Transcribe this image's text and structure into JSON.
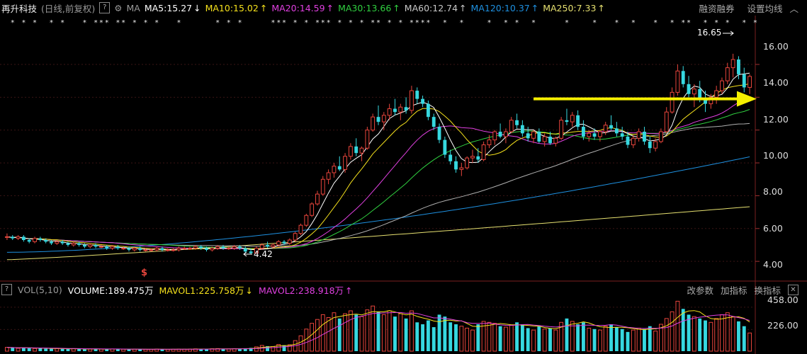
{
  "header": {
    "stock_name": "再升科技",
    "period": "(日线,前复权)",
    "help_label": "?",
    "ma_label": "MA",
    "ma5": "MA5:15.27",
    "ma10": "MA10:15.02",
    "ma20": "MA20:14.59",
    "ma30": "MA30:13.66",
    "ma60": "MA60:12.74",
    "ma120": "MA120:10.37",
    "ma250": "MA250:7.33",
    "arrow_down": "↓",
    "arrow_up": "↑",
    "margin_trading": "融资融券",
    "set_ma": "设置均线"
  },
  "volume_header": {
    "indicator": "VOL(5,10)",
    "volume": "VOLUME:189.475万",
    "mavol1": "MAVOL1:225.758万",
    "mavol2": "MAVOL2:238.918万",
    "change_params": "改参数",
    "add_indicator": "加指标",
    "switch_indicator": "换指标",
    "close_label": "✕"
  },
  "annotations": {
    "high_label": "16.65",
    "low_label": "4.42",
    "dollar_mark": "$"
  },
  "colors": {
    "up": "#e8453c",
    "down": "#36d8e0",
    "ma5": "#ffffff",
    "ma10": "#f5e11c",
    "ma20": "#e040e0",
    "ma30": "#30d040",
    "ma60": "#b0b0b0",
    "ma120": "#1e90e0",
    "ma250": "#e6e070",
    "trend_arrow": "#f5f000"
  },
  "chart_data": [
    {
      "type": "candlestick",
      "title": "再升科技 (日线,前复权)",
      "y_ticks": [
        "16.00",
        "14.00",
        "12.00",
        "10.00",
        "8.00",
        "6.00",
        "4.00"
      ],
      "ylim": [
        3.1,
        18.2
      ],
      "high": 16.65,
      "low": 4.42,
      "grid": true,
      "trend_arrow_level": 13.9,
      "candles": [
        [
          5.5,
          5.7,
          5.3,
          5.5
        ],
        [
          5.5,
          5.6,
          5.3,
          5.4
        ],
        [
          5.4,
          5.6,
          5.3,
          5.5
        ],
        [
          5.5,
          5.6,
          5.2,
          5.3
        ],
        [
          5.3,
          5.4,
          5.1,
          5.2
        ],
        [
          5.2,
          5.5,
          5.1,
          5.4
        ],
        [
          5.4,
          5.5,
          5.2,
          5.3
        ],
        [
          5.3,
          5.4,
          5.1,
          5.2
        ],
        [
          5.2,
          5.3,
          5.0,
          5.1
        ],
        [
          5.1,
          5.3,
          5.0,
          5.2
        ],
        [
          5.2,
          5.3,
          5.0,
          5.1
        ],
        [
          5.1,
          5.2,
          4.9,
          5.0
        ],
        [
          5.0,
          5.2,
          4.9,
          5.1
        ],
        [
          5.1,
          5.2,
          4.9,
          5.0
        ],
        [
          5.0,
          5.1,
          4.8,
          4.9
        ],
        [
          4.9,
          5.1,
          4.8,
          5.0
        ],
        [
          5.0,
          5.1,
          4.8,
          4.9
        ],
        [
          4.9,
          5.0,
          4.8,
          4.9
        ],
        [
          4.9,
          5.0,
          4.7,
          4.8
        ],
        [
          4.8,
          5.0,
          4.7,
          4.9
        ],
        [
          4.9,
          5.0,
          4.7,
          4.8
        ],
        [
          4.8,
          4.9,
          4.7,
          4.8
        ],
        [
          4.8,
          4.9,
          4.6,
          4.7
        ],
        [
          4.7,
          4.9,
          4.6,
          4.8
        ],
        [
          4.8,
          4.9,
          4.6,
          4.7
        ],
        [
          4.7,
          4.8,
          4.6,
          4.7
        ],
        [
          4.7,
          4.8,
          4.6,
          4.7
        ],
        [
          4.7,
          4.9,
          4.6,
          4.8
        ],
        [
          4.8,
          4.9,
          4.6,
          4.7
        ],
        [
          4.7,
          4.8,
          4.6,
          4.7
        ],
        [
          4.7,
          4.8,
          4.6,
          4.7
        ],
        [
          4.7,
          4.9,
          4.6,
          4.8
        ],
        [
          4.8,
          4.9,
          4.7,
          4.8
        ],
        [
          4.8,
          4.9,
          4.7,
          4.8
        ],
        [
          4.8,
          5.0,
          4.7,
          4.9
        ],
        [
          4.9,
          5.0,
          4.7,
          4.8
        ],
        [
          4.8,
          4.9,
          4.6,
          4.7
        ],
        [
          4.7,
          4.9,
          4.6,
          4.8
        ],
        [
          4.8,
          5.0,
          4.7,
          4.9
        ],
        [
          4.9,
          5.0,
          4.7,
          4.8
        ],
        [
          4.8,
          4.9,
          4.7,
          4.8
        ],
        [
          4.8,
          5.0,
          4.7,
          4.9
        ],
        [
          4.9,
          5.0,
          4.7,
          4.8
        ],
        [
          4.8,
          4.9,
          4.5,
          4.6
        ],
        [
          4.6,
          4.8,
          4.42,
          4.5
        ],
        [
          4.5,
          4.9,
          4.5,
          4.8
        ],
        [
          4.8,
          5.1,
          4.7,
          5.0
        ],
        [
          5.0,
          5.2,
          4.8,
          4.9
        ],
        [
          4.9,
          5.1,
          4.8,
          5.0
        ],
        [
          5.0,
          5.3,
          4.9,
          5.2
        ],
        [
          5.2,
          5.3,
          5.0,
          5.1
        ],
        [
          5.1,
          5.4,
          5.0,
          5.3
        ],
        [
          5.3,
          5.8,
          5.2,
          5.7
        ],
        [
          5.7,
          6.3,
          5.6,
          6.2
        ],
        [
          6.2,
          6.9,
          6.1,
          6.8
        ],
        [
          6.8,
          7.6,
          6.7,
          7.5
        ],
        [
          7.5,
          8.3,
          7.4,
          8.1
        ],
        [
          8.1,
          9.2,
          8.0,
          9.0
        ],
        [
          9.0,
          9.6,
          8.7,
          9.4
        ],
        [
          9.4,
          10.0,
          9.1,
          9.8
        ],
        [
          9.8,
          10.4,
          9.5,
          9.6
        ],
        [
          9.6,
          10.6,
          9.4,
          10.4
        ],
        [
          10.4,
          11.2,
          10.2,
          11.0
        ],
        [
          11.0,
          11.5,
          10.4,
          10.6
        ],
        [
          10.6,
          11.0,
          10.1,
          10.9
        ],
        [
          10.9,
          12.2,
          10.8,
          12.0
        ],
        [
          12.0,
          13.0,
          11.9,
          12.8
        ],
        [
          12.8,
          13.5,
          12.3,
          12.5
        ],
        [
          12.5,
          13.1,
          12.0,
          12.9
        ],
        [
          12.9,
          13.6,
          12.6,
          13.3
        ],
        [
          13.3,
          13.9,
          12.9,
          13.1
        ],
        [
          13.1,
          13.6,
          12.6,
          13.4
        ],
        [
          13.4,
          14.0,
          13.0,
          13.2
        ],
        [
          13.2,
          14.7,
          13.0,
          14.4
        ],
        [
          14.4,
          14.6,
          13.6,
          13.9
        ],
        [
          13.9,
          14.1,
          13.4,
          13.6
        ],
        [
          13.6,
          13.8,
          12.6,
          12.8
        ],
        [
          12.8,
          13.0,
          12.0,
          12.2
        ],
        [
          12.2,
          12.4,
          11.2,
          11.4
        ],
        [
          11.4,
          11.6,
          10.3,
          10.5
        ],
        [
          10.5,
          10.8,
          9.9,
          10.1
        ],
        [
          10.1,
          10.4,
          9.4,
          9.6
        ],
        [
          9.6,
          10.0,
          9.2,
          9.7
        ],
        [
          9.7,
          10.4,
          9.6,
          10.3
        ],
        [
          10.3,
          10.8,
          10.0,
          10.4
        ],
        [
          10.4,
          10.9,
          10.0,
          10.2
        ],
        [
          10.2,
          11.3,
          10.1,
          11.1
        ],
        [
          11.1,
          11.7,
          10.9,
          11.4
        ],
        [
          11.4,
          12.0,
          11.1,
          11.9
        ],
        [
          11.9,
          12.4,
          11.5,
          11.6
        ],
        [
          11.6,
          12.1,
          11.2,
          11.9
        ],
        [
          11.9,
          12.8,
          11.8,
          12.6
        ],
        [
          12.6,
          13.0,
          12.1,
          12.3
        ],
        [
          12.3,
          12.6,
          11.6,
          11.8
        ],
        [
          11.8,
          12.2,
          11.3,
          11.5
        ],
        [
          11.5,
          12.0,
          11.2,
          11.9
        ],
        [
          11.9,
          12.1,
          11.2,
          11.3
        ],
        [
          11.3,
          11.8,
          11.0,
          11.6
        ],
        [
          11.6,
          11.9,
          11.1,
          11.2
        ],
        [
          11.2,
          11.6,
          11.0,
          11.5
        ],
        [
          11.5,
          12.8,
          11.4,
          12.6
        ],
        [
          12.6,
          13.3,
          12.3,
          12.5
        ],
        [
          12.5,
          13.1,
          12.2,
          12.9
        ],
        [
          12.9,
          13.2,
          12.0,
          12.2
        ],
        [
          12.2,
          12.6,
          11.4,
          11.6
        ],
        [
          11.6,
          12.0,
          11.3,
          11.8
        ],
        [
          11.8,
          12.1,
          11.4,
          11.6
        ],
        [
          11.6,
          12.0,
          11.3,
          11.9
        ],
        [
          11.9,
          12.5,
          11.7,
          12.3
        ],
        [
          12.3,
          12.9,
          12.0,
          12.1
        ],
        [
          12.1,
          12.5,
          11.6,
          11.8
        ],
        [
          11.8,
          12.2,
          11.4,
          11.6
        ],
        [
          11.6,
          11.9,
          10.9,
          11.1
        ],
        [
          11.1,
          11.7,
          10.9,
          11.5
        ],
        [
          11.5,
          12.1,
          11.3,
          11.9
        ],
        [
          11.9,
          12.2,
          11.1,
          11.3
        ],
        [
          11.3,
          11.6,
          10.6,
          10.9
        ],
        [
          10.9,
          11.5,
          10.7,
          11.3
        ],
        [
          11.3,
          12.1,
          11.2,
          11.9
        ],
        [
          11.9,
          13.4,
          11.8,
          13.1
        ],
        [
          13.1,
          14.6,
          13.0,
          14.3
        ],
        [
          14.3,
          16.0,
          14.1,
          15.6
        ],
        [
          15.6,
          15.9,
          14.6,
          14.8
        ],
        [
          14.8,
          15.3,
          14.0,
          14.2
        ],
        [
          14.2,
          14.8,
          13.4,
          14.5
        ],
        [
          14.5,
          15.0,
          13.7,
          13.9
        ],
        [
          13.9,
          14.4,
          13.1,
          13.6
        ],
        [
          13.6,
          14.2,
          13.3,
          14.0
        ],
        [
          14.0,
          14.7,
          13.6,
          14.4
        ],
        [
          14.4,
          15.2,
          14.2,
          15.0
        ],
        [
          15.0,
          16.1,
          14.8,
          15.8
        ],
        [
          15.8,
          16.65,
          15.2,
          16.3
        ],
        [
          16.3,
          16.5,
          15.1,
          15.4
        ],
        [
          15.4,
          15.8,
          14.3,
          14.6
        ],
        [
          14.6,
          15.4,
          14.2,
          15.27
        ]
      ]
    },
    {
      "type": "bar",
      "title": "VOL(5,10)",
      "y_ticks": [
        "458.00",
        "226.00"
      ],
      "ylim": [
        0,
        560
      ],
      "unit": "万",
      "values": [
        40,
        35,
        30,
        38,
        32,
        28,
        30,
        26,
        25,
        28,
        24,
        22,
        26,
        24,
        20,
        22,
        25,
        21,
        20,
        23,
        22,
        20,
        19,
        21,
        20,
        18,
        19,
        22,
        20,
        18,
        19,
        21,
        20,
        22,
        24,
        23,
        21,
        25,
        27,
        24,
        23,
        26,
        25,
        30,
        34,
        45,
        60,
        52,
        48,
        70,
        62,
        66,
        110,
        160,
        230,
        290,
        330,
        380,
        350,
        400,
        340,
        390,
        420,
        380,
        360,
        430,
        470,
        410,
        380,
        420,
        360,
        390,
        340,
        420,
        300,
        280,
        320,
        250,
        380,
        360,
        300,
        280,
        260,
        240,
        220,
        280,
        310,
        300,
        290,
        260,
        250,
        270,
        300,
        280,
        240,
        220,
        260,
        230,
        240,
        220,
        300,
        340,
        310,
        280,
        300,
        240,
        230,
        220,
        260,
        280,
        250,
        230,
        200,
        220,
        240,
        230,
        260,
        210,
        280,
        340,
        410,
        520,
        440,
        380,
        360,
        340,
        320,
        300,
        340,
        380,
        400,
        360,
        310,
        260,
        189.475
      ]
    }
  ]
}
